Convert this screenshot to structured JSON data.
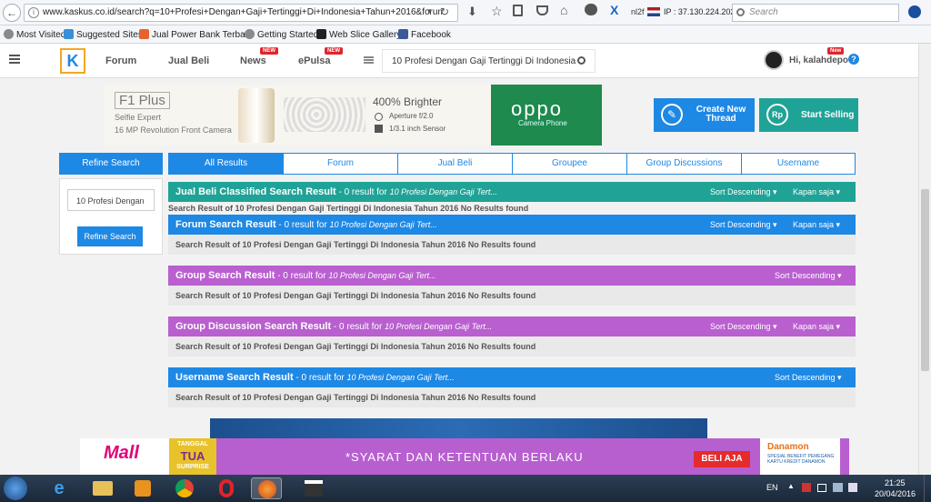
{
  "browser": {
    "url": "www.kaskus.co.id/search?q=10+Profesi+Dengan+Gaji+Tertinggi+Di+Indonesia+Tahun+2016&forumcl",
    "search_placeholder": "Search",
    "nl_label": "nl2f",
    "ip_label": "IP : 37.130.224.202",
    "bookmarks": [
      "Most Visited",
      "Suggested Sites",
      "Jual Power Bank Terba...",
      "Getting Started",
      "Web Slice Gallery",
      "Facebook"
    ]
  },
  "site": {
    "nav": [
      "Forum",
      "Jual Beli",
      "News",
      "ePulsa"
    ],
    "new_badge": "NEW",
    "search_value": "10 Profesi Dengan Gaji Tertinggi Di Indonesia",
    "user_greeting": "Hi, kalahdepo",
    "user_new_badge": "New",
    "help_icon": "?"
  },
  "banner": {
    "phone_brand": "F1 Plus",
    "phone_sub": "Selfie Expert",
    "phone_desc": "16 MP Revolution Front Camera",
    "bright": "400% Brighter",
    "aperture": "Aperture f/2.0",
    "sensor": "1/3.1 inch Sensor",
    "oppo_logo": "oppo",
    "oppo_sub": "Camera Phone"
  },
  "actions": {
    "create_thread": "Create New Thread",
    "start_selling": "Start Selling",
    "rp": "Rp"
  },
  "refine": {
    "header": "Refine Search",
    "input_value": "10 Profesi Dengan",
    "button": "Refine Search"
  },
  "tabs": [
    "All Results",
    "Forum",
    "Jual Beli",
    "Groupee",
    "Group Discussions",
    "Username"
  ],
  "sections": [
    {
      "title": "Jual Beli Classified Search Result",
      "count": " - 0 result for ",
      "query": "10 Profesi Dengan Gaji Tert...",
      "sort": "Sort Descending",
      "time": "Kapan saja",
      "body": "Search Result of 10 Profesi Dengan Gaji Tertinggi Di Indonesia Tahun 2016 No Results found",
      "color": "#1fa397"
    },
    {
      "title": "Forum Search Result",
      "count": " - 0 result for ",
      "query": "10 Profesi Dengan Gaji Tert...",
      "sort": "Sort Descending",
      "time": "Kapan saja",
      "body": "Search Result of 10 Profesi Dengan Gaji Tertinggi Di Indonesia Tahun 2016 No Results found",
      "color": "#1e88e5"
    },
    {
      "title": "Group Search Result",
      "count": " - 0 result for ",
      "query": "10 Profesi Dengan Gaji Tert...",
      "sort": "Sort Descending",
      "body": "Search Result of 10 Profesi Dengan Gaji Tertinggi Di Indonesia Tahun 2016 No Results found",
      "color": "#b95fcf"
    },
    {
      "title": "Group Discussion Search Result",
      "count": " - 0 result for ",
      "query": "10 Profesi Dengan Gaji Tert...",
      "sort": "Sort Descending",
      "time": "Kapan saja",
      "body": "Search Result of 10 Profesi Dengan Gaji Tertinggi Di Indonesia Tahun 2016 No Results found",
      "color": "#b95fcf"
    },
    {
      "title": "Username Search Result",
      "count": " - 0 result for ",
      "query": "10 Profesi Dengan Gaji Tert...",
      "sort": "Sort Descending",
      "body": "Search Result of 10 Profesi Dengan Gaji Tertinggi Di Indonesia Tahun 2016 No Results found",
      "color": "#1e88e5"
    }
  ],
  "ad": {
    "mall": "Mall",
    "tanggal": "TANGGAL",
    "tua": "TUA",
    "surprise": "SURPRISE",
    "syarat": "*SYARAT DAN KETENTUAN BERLAKU",
    "beli": "BELI AJA",
    "danamon": "Danamon",
    "danamon_sub": "SPESIAL BENEFIT PEMEGANG KARTU KREDIT DANAMON"
  },
  "taskbar": {
    "lang": "EN",
    "time": "21:25",
    "date": "20/04/2016"
  }
}
